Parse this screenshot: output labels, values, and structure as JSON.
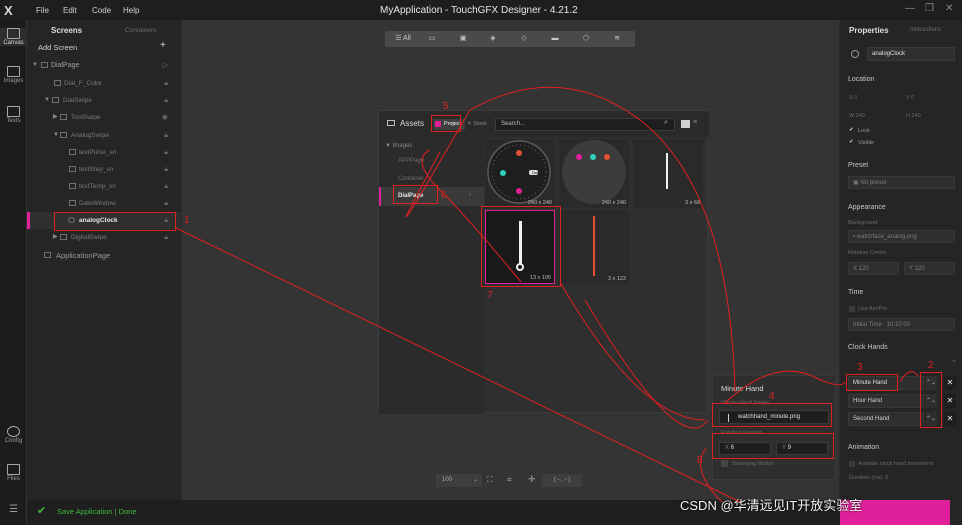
{
  "titlebar": {
    "app_title": "MyApplication - TouchGFX Designer - 4.21.2",
    "menu": [
      "File",
      "Edit",
      "Code",
      "Help"
    ]
  },
  "rail": {
    "items": [
      {
        "label": "Canvas",
        "icon": "canvas-icon"
      },
      {
        "label": "Images",
        "icon": "images-icon"
      },
      {
        "label": "Texts",
        "icon": "texts-icon"
      },
      {
        "label": "Config",
        "icon": "gear-icon"
      },
      {
        "label": "Files",
        "icon": "folder-icon"
      }
    ]
  },
  "screens_panel": {
    "tab_screens": "Screens",
    "tab_containers": "Containers",
    "add_screen": "Add Screen",
    "tree": [
      {
        "label": "DialPage"
      },
      {
        "label": "Dial_F_Color"
      },
      {
        "label": "DialSwipe"
      },
      {
        "label": "ToolSwipe"
      },
      {
        "label": "AnalogSwipe"
      },
      {
        "label": "textPulse_sn"
      },
      {
        "label": "textStep_sn"
      },
      {
        "label": "textTemp_sn"
      },
      {
        "label": "DateWindow"
      },
      {
        "label": "analogClock"
      },
      {
        "label": "DigitalSwipe"
      },
      {
        "label": "ApplicationPage"
      }
    ]
  },
  "toolbar": {
    "all_label": "All"
  },
  "assets": {
    "title": "Assets",
    "tab_project": "Project",
    "tab_stock": "Stock",
    "search_placeholder": "Search...",
    "nav": [
      "Images",
      "APPPage",
      "Container",
      "DialPage"
    ],
    "thumbs": [
      {
        "size": "240 x 240"
      },
      {
        "size": "240 x 240"
      },
      {
        "size": "3 x 68"
      },
      {
        "size": "13 x 105"
      },
      {
        "size": "3 x 123"
      }
    ],
    "date_badge": "Date"
  },
  "properties": {
    "title": "Properties",
    "tab_interactions": "Interactions",
    "component_name": "analogClock",
    "location": "Location",
    "x_label": "X",
    "x_value": "0",
    "y_label": "Y",
    "y_value": "0",
    "w_label": "W",
    "w_value": "240",
    "h_label": "H",
    "h_value": "240",
    "lock": "Lock",
    "visible": "Visible",
    "preset": "Preset",
    "preset_value": "No preset",
    "appearance": "Appearance",
    "background_label": "Background",
    "background_value": "watchface_analog.png",
    "rotation_center": "Rotation Center",
    "rc_x": "120",
    "rc_y": "120",
    "time": "Time",
    "use_ampm": "Use Am/Pm",
    "initial_time": "Initial Time",
    "initial_time_value": "10:10:00",
    "clock_hands": "Clock Hands",
    "hands": [
      "Minute Hand",
      "Hour Hand",
      "Second Hand"
    ],
    "animation": "Animation",
    "animate_movement": "Animate clock hand movement",
    "duration": "Duration (ms): 0"
  },
  "popup": {
    "title": "Minute Hand",
    "image_label": "Minute Hand Image",
    "image_value": "watchhand_minute.png",
    "rotation_label": "Rotation Position",
    "x_value": "6",
    "y_value": "9",
    "sweeping": "Sweeping Motion"
  },
  "canvas_bottom": {
    "zoom": "100",
    "coords": "( - , - )"
  },
  "status": {
    "text": "Save Application  |  Done"
  },
  "watermark": "CSDN @华清远见IT开放实验室",
  "annotations": [
    "1",
    "2",
    "3",
    "4",
    "5",
    "6",
    "7",
    "8"
  ],
  "colors": {
    "annotation": "#e02020",
    "accent": "#e0209a",
    "status_ok": "#3cba3c"
  }
}
